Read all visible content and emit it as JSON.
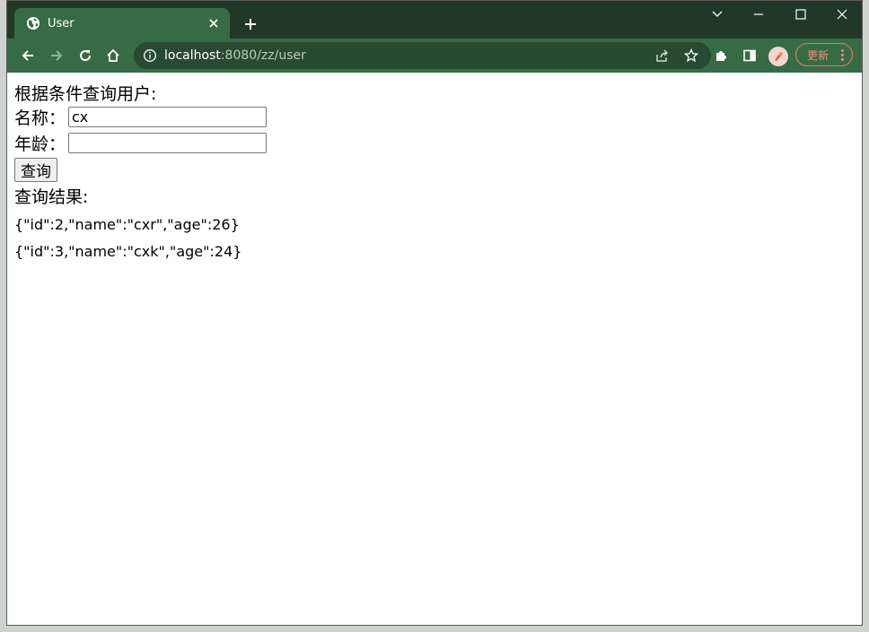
{
  "browser": {
    "tab_title": "User",
    "url_host": "localhost",
    "url_rest": ":8080/zz/user",
    "update_label": "更新"
  },
  "page": {
    "heading": "根据条件查询用户:",
    "name_label": "名称：",
    "name_value": "cx",
    "age_label": "年龄：",
    "age_value": "",
    "query_button": "查询",
    "results_title": "查询结果:",
    "results": [
      "{\"id\":2,\"name\":\"cxr\",\"age\":26}",
      "{\"id\":3,\"name\":\"cxk\",\"age\":24}"
    ]
  },
  "colors": {
    "tab_strip": "#223826",
    "toolbar": "#376b45",
    "omnibox": "#274a30",
    "update_accent": "#f28b82"
  },
  "icons": [
    "globe-icon",
    "close-icon",
    "plus-icon",
    "chevron-down-icon",
    "minimize-icon",
    "maximize-icon",
    "window-close-icon",
    "back-icon",
    "forward-icon",
    "reload-icon",
    "home-icon",
    "info-icon",
    "share-icon",
    "star-icon",
    "extensions-icon",
    "side-panel-icon",
    "avatar",
    "more-icon"
  ]
}
